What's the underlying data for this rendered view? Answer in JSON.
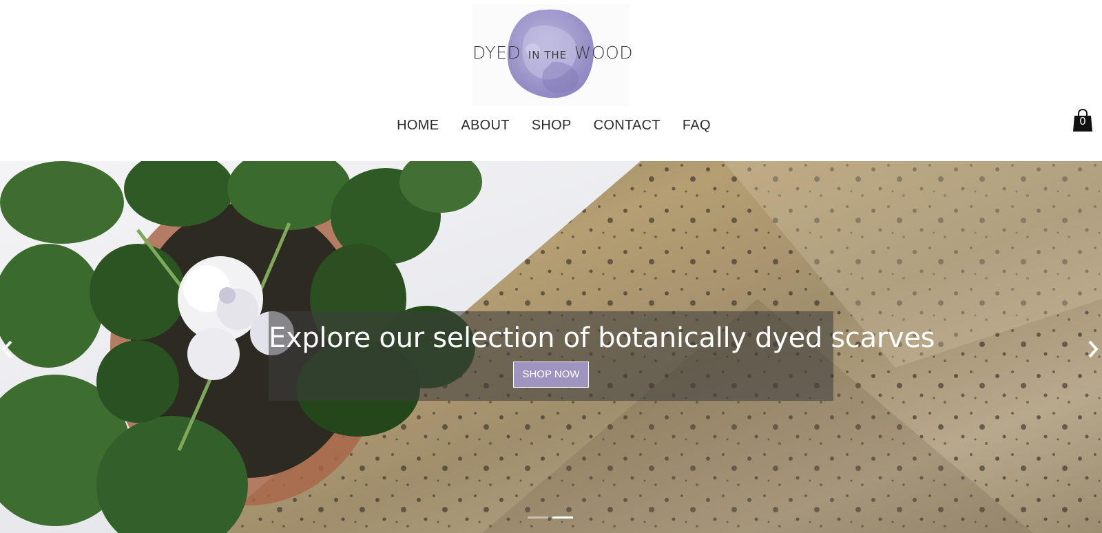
{
  "brand": {
    "logo_word_1": "DYED",
    "logo_word_2": "IN THE",
    "logo_word_3": "WOOD",
    "logo_blot_color": "#9d97c9"
  },
  "nav": {
    "items": [
      {
        "label": "HOME"
      },
      {
        "label": "ABOUT"
      },
      {
        "label": "SHOP"
      },
      {
        "label": "CONTACT"
      },
      {
        "label": "FAQ"
      }
    ]
  },
  "cart": {
    "icon": "shopping-bag-icon",
    "count": "0"
  },
  "hero": {
    "title": "Explore our selection of botanically dyed scarves",
    "button_label": "SHOP NOW",
    "button_color": "#9f94c0",
    "prev_icon": "chevron-left-icon",
    "next_icon": "chevron-right-icon",
    "slide_count": 2,
    "active_slide": 2
  }
}
